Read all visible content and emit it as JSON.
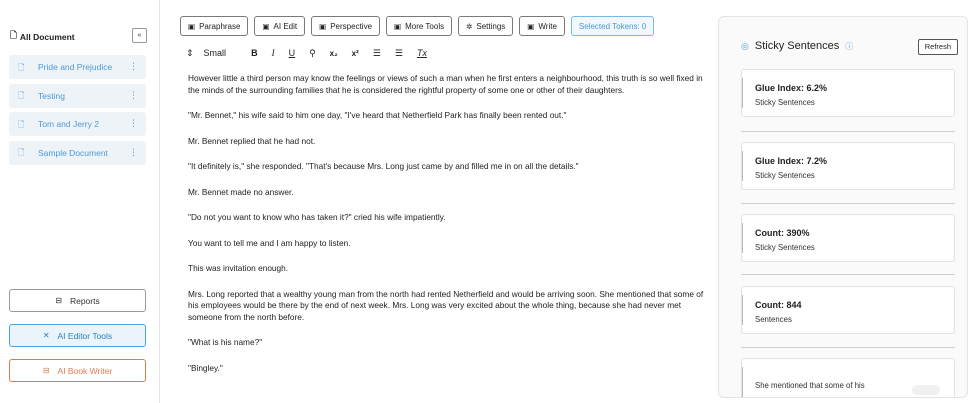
{
  "sidebar": {
    "title": "All Document",
    "collapse": "«",
    "documents": [
      {
        "label": "Pride and Prejudice"
      },
      {
        "label": "Testing"
      },
      {
        "label": "Tom and Jerry 2"
      },
      {
        "label": "Sample Document"
      }
    ],
    "more_glyph": "⋮",
    "reports_label": "Reports",
    "ai_editor_tools_label": "AI Editor Tools",
    "ai_book_writer_label": "AI Book Writer"
  },
  "toolbar": {
    "paraphrase": "Paraphrase",
    "ai_edit": "AI Edit",
    "perspective": "Perspective",
    "more_tools": "More Tools",
    "settings": "Settings",
    "write": "Write",
    "selected_tokens": "Selected Tokens: 0"
  },
  "format": {
    "size_arrows": "⇕",
    "size": "Small",
    "bold": "B",
    "italic": "I",
    "underline": "U",
    "link": "⚲",
    "subscript": "x₂",
    "superscript": "x²",
    "ordered_list": "☰",
    "bullet_list": "☰",
    "clear": "Tx"
  },
  "editor": {
    "paragraphs": [
      "However little a third person may know the feelings or views of such a man when he first enters a neighbourhood, this truth is so well fixed in the minds of the surrounding families that he is considered the rightful property of some one or other of their daughters.",
      "\"Mr. Bennet,\" his wife said to him one day, \"I've heard that Netherfield Park has finally been rented out.\"",
      "Mr. Bennet replied that he had not.",
      "\"It definitely is,\" she responded. \"That's because Mrs. Long just came by and filled me in on all the details.\"",
      "Mr. Bennet made no answer.",
      "\"Do not you want to know who has taken it?\" cried his wife impatiently.",
      "You want to tell me and I am happy to listen.",
      "This was invitation enough.",
      "Mrs. Long reported that a wealthy young man from the north had rented Netherfield and would be arriving soon. She mentioned that some of his employees would be there by the end of next week. Mrs. Long was very excited about the whole thing, because she had never met someone from the north before.",
      "\"What is his name?\"",
      "\"Bingley.\""
    ]
  },
  "panel": {
    "title": "Sticky Sentences",
    "refresh_label": "Refresh",
    "cards": [
      {
        "title": "Glue Index: 6.2%",
        "subtitle": "Sticky Sentences"
      },
      {
        "title": "Glue Index: 7.2%",
        "subtitle": "Sticky Sentences"
      },
      {
        "title": "Count: 390%",
        "subtitle": "Sticky Sentences"
      },
      {
        "title": "Count: 844",
        "subtitle": "Sentences"
      }
    ],
    "last_card_text": "She mentioned that some of his"
  },
  "colors": {
    "accent": "#4a9ad6",
    "writer": "#e07b4f"
  }
}
